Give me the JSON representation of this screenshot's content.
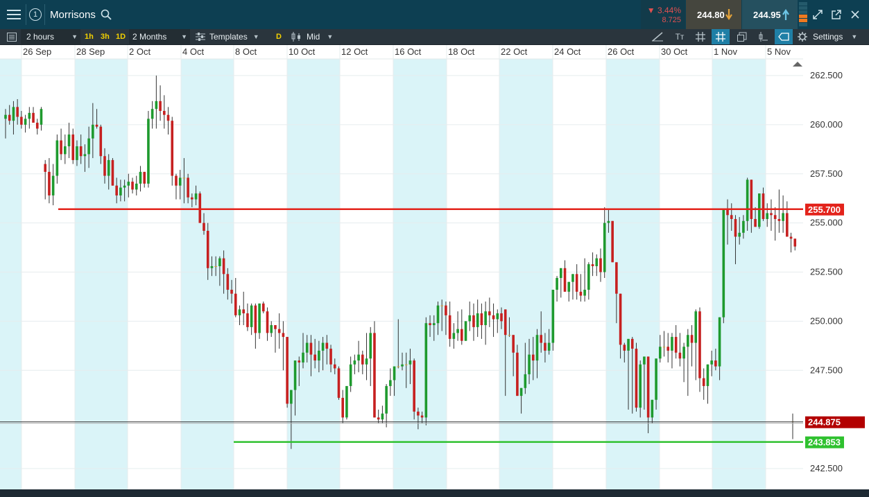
{
  "header": {
    "badge_number": "1",
    "instrument": "Morrisons",
    "change_percent": "▼ 3.44%",
    "change_value": "8.725",
    "sell_price": "244.80",
    "buy_price": "244.95"
  },
  "toolbar": {
    "interval": "2 hours",
    "quick_intervals": [
      "1h",
      "3h",
      "1D"
    ],
    "range": "2 Months",
    "templates_label": "Templates",
    "d_label": "D",
    "price_type": "Mid",
    "text_tool_label": "Tт",
    "settings_label": "Settings"
  },
  "colors": {
    "up": "#1e9a2e",
    "down": "#c62020",
    "doji": "#e0a030",
    "band": "#daf4f8",
    "resistance": "#e3231b",
    "support": "#2fc12f",
    "current_price": "#b30000"
  },
  "chart_data": {
    "type": "candlestick",
    "x_tick_labels": [
      "26 Sep",
      "28 Sep",
      "2 Oct",
      "4 Oct",
      "8 Oct",
      "10 Oct",
      "12 Oct",
      "16 Oct",
      "18 Oct",
      "22 Oct",
      "24 Oct",
      "26 Oct",
      "30 Oct",
      "1 Nov",
      "5 Nov"
    ],
    "y_ticks": [
      "262.500",
      "260.000",
      "257.500",
      "255.000",
      "252.500",
      "250.000",
      "247.500",
      "242.500"
    ],
    "y_range": [
      242,
      263.5
    ],
    "grid": true,
    "resistance_level": "255.700",
    "support_level": "243.853",
    "current_price": "244.875",
    "candles": [
      [
        0,
        260.3,
        260.8,
        259.3,
        260.5
      ],
      [
        1,
        260.5,
        261.0,
        260.0,
        260.2
      ],
      [
        2,
        260.2,
        261.2,
        259.5,
        260.9
      ],
      [
        3,
        260.9,
        261.3,
        260.0,
        260.4
      ],
      [
        4,
        260.4,
        260.7,
        259.8,
        260.0
      ],
      [
        5,
        260.0,
        260.5,
        259.6,
        260.3
      ],
      [
        6,
        260.3,
        260.9,
        259.8,
        260.6
      ],
      [
        7,
        260.6,
        260.9,
        260.1,
        260.1
      ],
      [
        8,
        260.1,
        260.3,
        259.5,
        259.8
      ],
      [
        9,
        260.0,
        260.9,
        259.7,
        260.8
      ],
      [
        10,
        258.0,
        258.2,
        256.2,
        257.6
      ],
      [
        11,
        257.6,
        258.3,
        256.0,
        256.4
      ],
      [
        12,
        256.4,
        258.0,
        255.9,
        257.4
      ],
      [
        13,
        257.4,
        259.5,
        257.0,
        259.2
      ],
      [
        14,
        259.2,
        259.8,
        258.2,
        258.5
      ],
      [
        15,
        258.5,
        259.5,
        258.0,
        258.9
      ],
      [
        16,
        258.9,
        260.1,
        258.3,
        259.5
      ],
      [
        17,
        259.5,
        259.8,
        258.0,
        258.2
      ],
      [
        18,
        258.2,
        259.2,
        257.9,
        258.9
      ],
      [
        19,
        258.9,
        259.5,
        258.0,
        258.4
      ],
      [
        20,
        258.4,
        259.0,
        257.6,
        258.5
      ],
      [
        21,
        258.5,
        259.9,
        257.8,
        259.3
      ],
      [
        22,
        259.3,
        261.1,
        258.3,
        260.0
      ],
      [
        23,
        260.0,
        260.8,
        259.8,
        259.9
      ],
      [
        24,
        259.9,
        260.0,
        258.0,
        258.4
      ],
      [
        25,
        258.4,
        258.8,
        257.0,
        257.4
      ],
      [
        26,
        257.4,
        258.5,
        256.7,
        258.2
      ],
      [
        27,
        258.2,
        258.3,
        256.9,
        256.9
      ],
      [
        28,
        256.9,
        257.3,
        256.0,
        256.4
      ],
      [
        29,
        256.4,
        257.2,
        256.1,
        256.8
      ],
      [
        30,
        256.8,
        257.2,
        256.1,
        256.9
      ],
      [
        31,
        256.9,
        257.5,
        256.3,
        257.1
      ],
      [
        32,
        257.1,
        257.3,
        256.5,
        256.7
      ],
      [
        33,
        256.7,
        257.4,
        256.4,
        257.0
      ],
      [
        34,
        257.0,
        257.9,
        256.6,
        257.6
      ],
      [
        35,
        257.6,
        257.6,
        256.8,
        257.0
      ],
      [
        36,
        257.0,
        260.7,
        256.8,
        260.3
      ],
      [
        37,
        260.3,
        261.2,
        259.8,
        260.8
      ],
      [
        38,
        260.8,
        262.5,
        259.8,
        261.2
      ],
      [
        39,
        261.2,
        262.0,
        260.2,
        260.7
      ],
      [
        40,
        260.7,
        261.5,
        259.8,
        260.5
      ],
      [
        41,
        260.5,
        260.9,
        259.5,
        260.2
      ],
      [
        42,
        260.2,
        260.4,
        256.9,
        257.4
      ],
      [
        43,
        257.4,
        257.5,
        256.2,
        256.9
      ],
      [
        44,
        256.9,
        257.7,
        256.2,
        257.3
      ],
      [
        45,
        257.3,
        258.3,
        256.0,
        257.3
      ],
      [
        46,
        257.3,
        257.5,
        256.0,
        256.3
      ],
      [
        47,
        256.3,
        256.5,
        255.8,
        256.2
      ],
      [
        48,
        256.2,
        256.9,
        255.9,
        256.5
      ],
      [
        49,
        256.5,
        256.6,
        255.2,
        255.0
      ],
      [
        50,
        255.0,
        255.5,
        254.4,
        254.6
      ],
      [
        51,
        254.6,
        255.0,
        252.1,
        252.7
      ],
      [
        52,
        252.7,
        253.3,
        252.3,
        252.8
      ],
      [
        53,
        252.8,
        253.3,
        252.3,
        252.8
      ],
      [
        54,
        252.8,
        253.3,
        251.8,
        253.2
      ],
      [
        55,
        253.2,
        253.6,
        251.4,
        252.4
      ],
      [
        56,
        252.4,
        252.7,
        251.1,
        251.6
      ],
      [
        57,
        251.6,
        252.1,
        250.9,
        251.4
      ],
      [
        58,
        251.4,
        252.2,
        250.2,
        250.3
      ],
      [
        59,
        250.3,
        250.8,
        249.8,
        250.6
      ],
      [
        60,
        250.6,
        251.5,
        249.8,
        250.4
      ],
      [
        61,
        250.4,
        250.9,
        249.5,
        249.7
      ],
      [
        62,
        249.7,
        250.9,
        249.3,
        250.8
      ],
      [
        63,
        250.8,
        250.9,
        248.6,
        249.4
      ],
      [
        64,
        249.4,
        250.9,
        249.1,
        250.9
      ],
      [
        65,
        250.9,
        251.0,
        250.4,
        250.5
      ],
      [
        66,
        250.5,
        250.7,
        249.0,
        249.4
      ],
      [
        67,
        249.4,
        250.0,
        249.2,
        249.8
      ],
      [
        68,
        249.8,
        249.8,
        248.4,
        249.6
      ],
      [
        69,
        249.6,
        250.4,
        248.6,
        249.4
      ],
      [
        70,
        249.4,
        250.0,
        247.5,
        249.2
      ],
      [
        71,
        249.2,
        249.2,
        245.6,
        245.8
      ],
      [
        72,
        245.8,
        246.5,
        243.5,
        246.5
      ],
      [
        73,
        246.5,
        248.0,
        245.2,
        248.0
      ],
      [
        74,
        248.0,
        248.2,
        246.7,
        247.9
      ],
      [
        75,
        247.9,
        249.4,
        247.6,
        248.4
      ],
      [
        76,
        248.4,
        249.3,
        247.9,
        248.9
      ],
      [
        77,
        248.9,
        249.3,
        247.2,
        248.3
      ],
      [
        78,
        248.3,
        249.1,
        247.6,
        248.0
      ],
      [
        79,
        248.0,
        249.0,
        247.4,
        248.5
      ],
      [
        80,
        248.5,
        249.2,
        247.5,
        248.9
      ],
      [
        81,
        248.9,
        249.3,
        247.8,
        248.6
      ],
      [
        82,
        248.6,
        248.8,
        247.4,
        247.8
      ],
      [
        83,
        247.8,
        248.1,
        247.3,
        247.6
      ],
      [
        84,
        247.6,
        247.7,
        246.0,
        246.1
      ],
      [
        85,
        246.1,
        246.5,
        244.8,
        245.1
      ],
      [
        86,
        245.1,
        246.5,
        245.0,
        246.7
      ],
      [
        87,
        246.7,
        248.2,
        246.4,
        247.8
      ],
      [
        88,
        247.8,
        248.3,
        247.3,
        248.0
      ],
      [
        89,
        248.0,
        249.0,
        247.4,
        248.3
      ],
      [
        90,
        248.3,
        248.5,
        247.3,
        247.8
      ],
      [
        91,
        247.8,
        249.4,
        247.0,
        248.1
      ],
      [
        92,
        248.1,
        249.7,
        246.7,
        249.4
      ],
      [
        93,
        249.4,
        250.0,
        245.5,
        245.1
      ],
      [
        94,
        245.1,
        245.5,
        244.8,
        245.0
      ],
      [
        95,
        245.0,
        245.7,
        244.8,
        245.3
      ],
      [
        96,
        245.3,
        246.8,
        244.6,
        246.7
      ],
      [
        97,
        246.7,
        247.6,
        246.2,
        247.0
      ],
      [
        98,
        247.0,
        247.7,
        246.2,
        247.7
      ],
      [
        99,
        247.7,
        250.1,
        247.6,
        247.7
      ],
      [
        100,
        247.7,
        248.4,
        247.5,
        247.8
      ],
      [
        101,
        247.8,
        248.4,
        246.6,
        247.8
      ],
      [
        102,
        247.8,
        248.6,
        246.8,
        248.0
      ],
      [
        103,
        248.0,
        248.1,
        245.0,
        245.4
      ],
      [
        104,
        245.4,
        245.6,
        244.5,
        245.2
      ],
      [
        105,
        245.2,
        245.4,
        244.8,
        245.1
      ],
      [
        106,
        245.1,
        250.2,
        244.7,
        249.9
      ],
      [
        107,
        249.9,
        250.3,
        249.2,
        249.8
      ],
      [
        108,
        249.8,
        250.3,
        249.0,
        249.9
      ],
      [
        109,
        249.9,
        251.0,
        249.3,
        250.8
      ],
      [
        110,
        250.8,
        251.1,
        249.5,
        250.8
      ],
      [
        111,
        250.8,
        251.0,
        249.3,
        250.3
      ],
      [
        112,
        250.3,
        251.0,
        248.7,
        249.1
      ],
      [
        113,
        249.1,
        249.9,
        248.6,
        249.4
      ],
      [
        114,
        249.4,
        250.5,
        249.0,
        249.6
      ],
      [
        115,
        249.6,
        250.6,
        248.8,
        249.0
      ],
      [
        116,
        249.0,
        250.0,
        249.0,
        250.0
      ],
      [
        117,
        250.0,
        251.0,
        249.5,
        250.3
      ],
      [
        118,
        250.3,
        250.9,
        249.0,
        249.7
      ],
      [
        119,
        249.7,
        251.1,
        249.2,
        250.4
      ],
      [
        120,
        250.4,
        250.9,
        249.1,
        249.8
      ],
      [
        121,
        249.8,
        251.0,
        248.8,
        250.5
      ],
      [
        122,
        250.5,
        251.2,
        249.7,
        250.3
      ],
      [
        123,
        250.3,
        250.9,
        249.2,
        250.1
      ],
      [
        124,
        250.1,
        250.6,
        249.4,
        250.4
      ],
      [
        125,
        250.4,
        250.7,
        249.6,
        250.0
      ],
      [
        126,
        250.6,
        250.6,
        246.2,
        249.3
      ],
      [
        127,
        249.3,
        250.2,
        249.2,
        249.3
      ],
      [
        128,
        249.3,
        249.3,
        247.2,
        248.4
      ],
      [
        129,
        248.4,
        248.8,
        246.2,
        246.2
      ],
      [
        130,
        246.2,
        246.5,
        245.3,
        246.6
      ],
      [
        131,
        246.6,
        248.9,
        246.3,
        247.3
      ],
      [
        132,
        247.3,
        249.1,
        246.8,
        248.3
      ],
      [
        133,
        248.3,
        249.2,
        247.0,
        248.0
      ],
      [
        134,
        248.0,
        249.6,
        247.1,
        249.3
      ],
      [
        135,
        249.3,
        250.5,
        248.4,
        248.9
      ],
      [
        136,
        248.9,
        249.4,
        247.9,
        248.5
      ],
      [
        137,
        248.5,
        249.6,
        248.3,
        248.9
      ],
      [
        138,
        248.9,
        251.4,
        248.5,
        251.6
      ],
      [
        139,
        251.6,
        252.3,
        251.0,
        252.2
      ],
      [
        140,
        252.2,
        252.5,
        251.2,
        252.7
      ],
      [
        141,
        252.7,
        253.1,
        251.9,
        251.5
      ],
      [
        142,
        251.5,
        252.0,
        251.0,
        252.0
      ],
      [
        143,
        252.0,
        252.2,
        251.1,
        252.4
      ],
      [
        144,
        252.4,
        252.9,
        251.1,
        251.5
      ],
      [
        145,
        251.5,
        252.4,
        251.0,
        251.3
      ],
      [
        146,
        251.3,
        253.2,
        251.0,
        251.6
      ],
      [
        147,
        251.6,
        253.0,
        251.1,
        252.9
      ],
      [
        148,
        252.9,
        253.5,
        252.3,
        252.8
      ],
      [
        149,
        252.8,
        253.4,
        252.3,
        253.2
      ],
      [
        150,
        253.2,
        253.7,
        252.0,
        252.5
      ],
      [
        151,
        252.5,
        255.8,
        252.2,
        255.0
      ],
      [
        152,
        255.0,
        255.7,
        254.5,
        255.1
      ],
      [
        153,
        255.1,
        253.2,
        253.5,
        253.0
      ],
      [
        154,
        253.0,
        252.3,
        249.9,
        251.4
      ],
      [
        155,
        251.4,
        251.2,
        248.1,
        248.8
      ],
      [
        156,
        248.8,
        248.9,
        247.9,
        248.5
      ],
      [
        157,
        248.5,
        249.0,
        245.5,
        249.1
      ],
      [
        158,
        249.1,
        249.2,
        245.3,
        248.6
      ],
      [
        159,
        248.6,
        248.9,
        245.4,
        245.6
      ],
      [
        160,
        245.6,
        248.0,
        245.1,
        247.8
      ],
      [
        161,
        247.8,
        248.2,
        245.5,
        248.2
      ],
      [
        162,
        248.2,
        247.9,
        244.3,
        245.1
      ],
      [
        163,
        245.1,
        246.0,
        244.8,
        246.0
      ],
      [
        164,
        246.0,
        248.1,
        245.5,
        248.1
      ],
      [
        165,
        248.1,
        249.3,
        247.9,
        248.7
      ],
      [
        166,
        248.7,
        249.5,
        248.2,
        248.7
      ],
      [
        167,
        248.7,
        249.4,
        247.9,
        248.5
      ],
      [
        168,
        248.5,
        249.4,
        247.6,
        249.2
      ],
      [
        169,
        249.2,
        249.8,
        248.1,
        248.4
      ],
      [
        170,
        248.4,
        249.4,
        247.7,
        248.1
      ],
      [
        171,
        248.1,
        248.9,
        246.9,
        248.7
      ],
      [
        172,
        248.7,
        249.6,
        246.2,
        249.3
      ],
      [
        173,
        249.3,
        249.8,
        247.7,
        248.9
      ],
      [
        174,
        248.9,
        250.6,
        247.0,
        250.5
      ],
      [
        175,
        250.5,
        250.7,
        246.4,
        247.1
      ],
      [
        176,
        247.1,
        247.6,
        246.0,
        246.7
      ],
      [
        177,
        246.7,
        247.8,
        245.8,
        247.8
      ],
      [
        178,
        247.8,
        248.5,
        247.2,
        248.0
      ],
      [
        179,
        248.0,
        248.6,
        247.5,
        247.7
      ],
      [
        180,
        247.7,
        248.6,
        247.0,
        250.2
      ],
      [
        181,
        250.2,
        250.7,
        249.9,
        255.7
      ],
      [
        182,
        255.7,
        256.2,
        253.9,
        255.4
      ],
      [
        183,
        255.4,
        256.0,
        254.6,
        255.2
      ],
      [
        184,
        255.2,
        255.4,
        252.9,
        254.3
      ],
      [
        185,
        254.3,
        255.3,
        253.9,
        254.5
      ],
      [
        186,
        254.5,
        255.4,
        254.2,
        255.1
      ],
      [
        187,
        255.1,
        257.3,
        254.6,
        257.2
      ],
      [
        188,
        257.2,
        256.1,
        254.5,
        255.2
      ],
      [
        189,
        255.2,
        255.8,
        254.8,
        254.8
      ],
      [
        190,
        254.8,
        256.0,
        254.7,
        256.5
      ],
      [
        191,
        256.5,
        256.8,
        255.1,
        255.2
      ],
      [
        192,
        255.2,
        256.0,
        254.8,
        255.5
      ],
      [
        193,
        255.5,
        256.2,
        254.6,
        255.4
      ],
      [
        194,
        255.4,
        255.8,
        254.1,
        255.2
      ],
      [
        195,
        255.2,
        256.7,
        254.5,
        255.1
      ],
      [
        196,
        255.1,
        256.4,
        254.5,
        255.5
      ],
      [
        197,
        255.5,
        256.1,
        254.3,
        254.3
      ],
      [
        198,
        254.3,
        254.5,
        253.5,
        254.2
      ],
      [
        199,
        254.2,
        254.2,
        253.6,
        253.8
      ],
      [
        200,
        244.9,
        245.3,
        244.0,
        244.9
      ]
    ]
  }
}
